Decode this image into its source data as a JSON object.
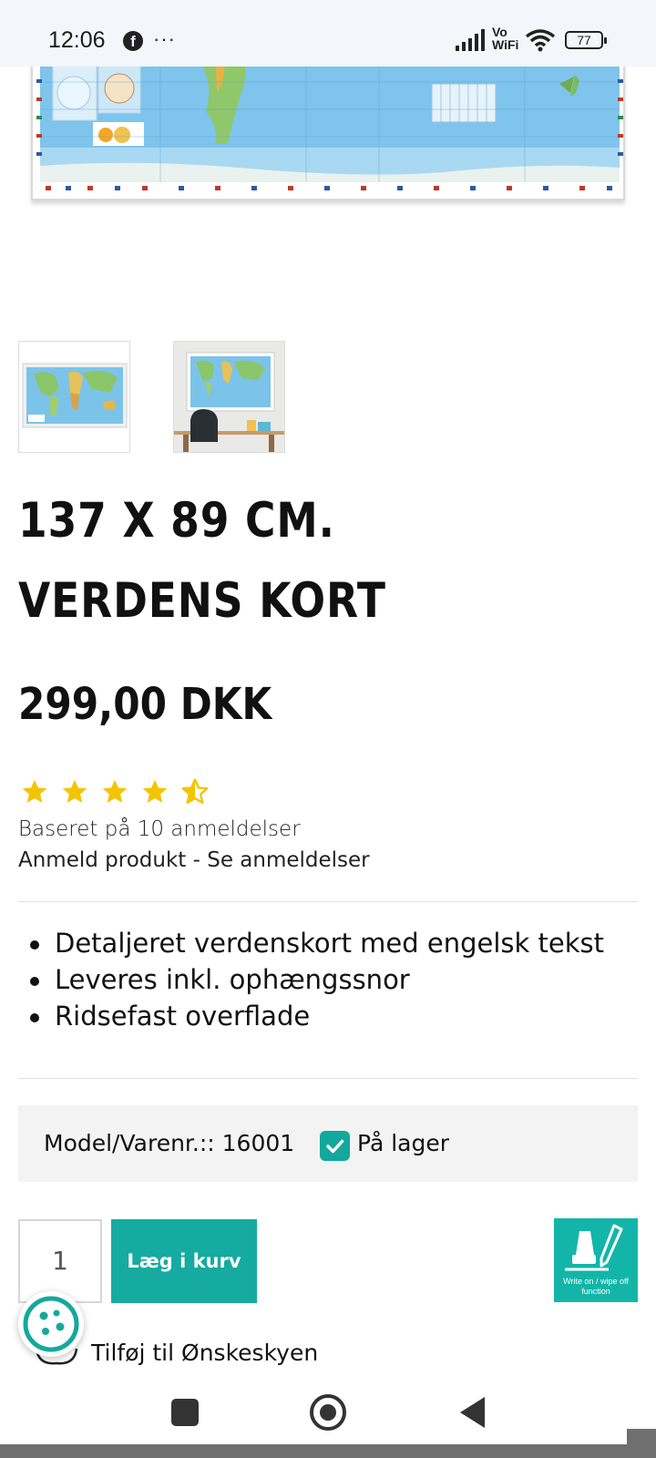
{
  "status_bar": {
    "time": "12:06",
    "notification_icons": [
      "facebook-icon",
      "more-dots-icon"
    ],
    "dots": "···",
    "network_label": "Vo\nWiFi",
    "battery": "77"
  },
  "product": {
    "images": {
      "main_alt": "137 x 89 cm. verdens kort",
      "thumbnails": [
        "map-only",
        "map-on-wall"
      ]
    },
    "title": "137 X 89 CM. VERDENS KORT",
    "price": "299,00 DKK",
    "rating": {
      "stars": 4.5,
      "max": 5,
      "based_on": "Baseret på 10 anmeldelser",
      "review_link": "Anmeld produkt",
      "separator": " - ",
      "see_reviews_link": "Se anmeldelser"
    },
    "features": [
      "Detaljeret verdenskort med engelsk tekst",
      "Leveres inkl. ophængssnor",
      "Ridsefast overflade"
    ],
    "model_label": "Model/Varenr.:: 16001",
    "stock_label": "På lager",
    "quantity": "1",
    "add_to_cart": "Læg i kurv",
    "badge_text": "Write on / wipe off function",
    "wishlist": "Tilføj til Ønskeskyen"
  },
  "colors": {
    "accent": "#15aba0",
    "star": "#f5c400",
    "text": "#111111"
  }
}
